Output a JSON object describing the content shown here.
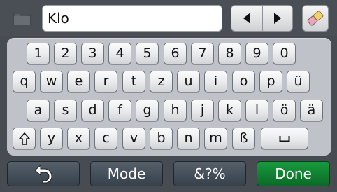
{
  "search": {
    "value": "Klo"
  },
  "icons": {
    "folder": "folder-icon",
    "prev": "arrow-left-icon",
    "next": "arrow-right-icon",
    "clear": "eraser-icon",
    "shift": "shift-icon",
    "space": "space-icon",
    "back": "back-arrow-icon"
  },
  "keyboard": {
    "row1": [
      "1",
      "2",
      "3",
      "4",
      "5",
      "6",
      "7",
      "8",
      "9",
      "0"
    ],
    "row2": [
      "q",
      "w",
      "e",
      "r",
      "t",
      "z",
      "u",
      "i",
      "o",
      "p",
      "ü"
    ],
    "row3": [
      "a",
      "s",
      "d",
      "f",
      "g",
      "h",
      "j",
      "k",
      "l",
      "ö",
      "ä"
    ],
    "row4": [
      "⇧",
      "y",
      "x",
      "c",
      "v",
      "b",
      "n",
      "m",
      "ß",
      "␣"
    ]
  },
  "buttons": {
    "mode": "Mode",
    "symbols": "&?%",
    "done": "Done"
  },
  "colors": {
    "background": "#474b52",
    "panel": "#bfc3c9",
    "done": "#128334"
  }
}
